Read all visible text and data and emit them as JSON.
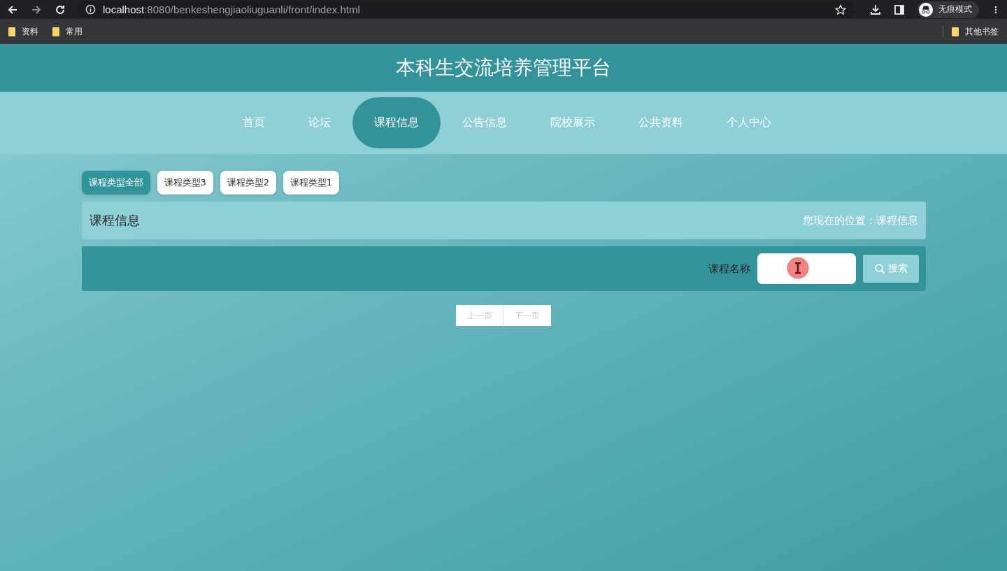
{
  "browser": {
    "url_host": "localhost",
    "url_rest": ":8080/benkeshengjiaoliuguanli/front/index.html",
    "incognito_label": "无痕模式",
    "bookmarks": [
      "资料",
      "常用"
    ],
    "other_bookmarks": "其他书签"
  },
  "site_title": "本科生交流培养管理平台",
  "nav": [
    {
      "label": "首页",
      "selected": false
    },
    {
      "label": "论坛",
      "selected": false
    },
    {
      "label": "课程信息",
      "selected": true
    },
    {
      "label": "公告信息",
      "selected": false
    },
    {
      "label": "院校展示",
      "selected": false
    },
    {
      "label": "公共资料",
      "selected": false
    },
    {
      "label": "个人中心",
      "selected": false
    }
  ],
  "categories": [
    {
      "label": "课程类型全部",
      "selected": true
    },
    {
      "label": "课程类型3",
      "selected": false
    },
    {
      "label": "课程类型2",
      "selected": false
    },
    {
      "label": "课程类型1",
      "selected": false
    }
  ],
  "section": {
    "title": "课程信息",
    "breadcrumb": "您现在的位置：课程信息"
  },
  "search": {
    "label": "课程名称",
    "button": "搜索"
  },
  "pagination": [
    {
      "label": "上一页",
      "disabled": true
    },
    {
      "label": "下一页",
      "disabled": true
    }
  ]
}
